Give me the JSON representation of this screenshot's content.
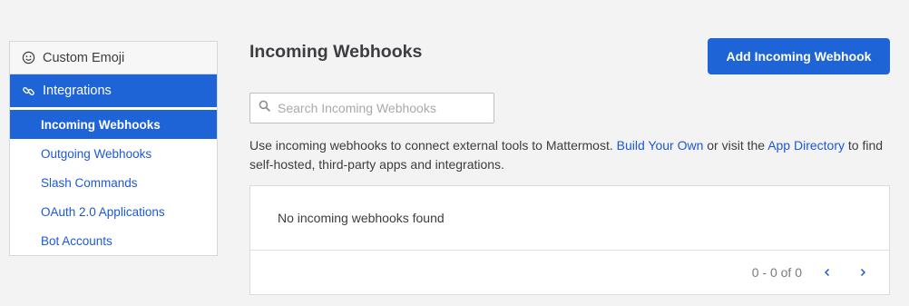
{
  "sidebar": {
    "custom_emoji": "Custom Emoji",
    "integrations": "Integrations",
    "items": [
      {
        "label": "Incoming Webhooks"
      },
      {
        "label": "Outgoing Webhooks"
      },
      {
        "label": "Slash Commands"
      },
      {
        "label": "OAuth 2.0 Applications"
      },
      {
        "label": "Bot Accounts"
      }
    ]
  },
  "header": {
    "title": "Incoming Webhooks",
    "add_button": "Add Incoming Webhook"
  },
  "search": {
    "placeholder": "Search Incoming Webhooks",
    "value": ""
  },
  "description": {
    "part1": "Use incoming webhooks to connect external tools to Mattermost. ",
    "link1": "Build Your Own",
    "part2": " or visit the ",
    "link2": "App Directory",
    "part3": " to find self-hosted, third-party apps and integrations."
  },
  "list": {
    "empty_message": "No incoming webhooks found",
    "pagination": "0 - 0 of 0"
  },
  "colors": {
    "accent": "#1e64d6",
    "link": "#1c58d9",
    "background": "#f3f3f3"
  }
}
